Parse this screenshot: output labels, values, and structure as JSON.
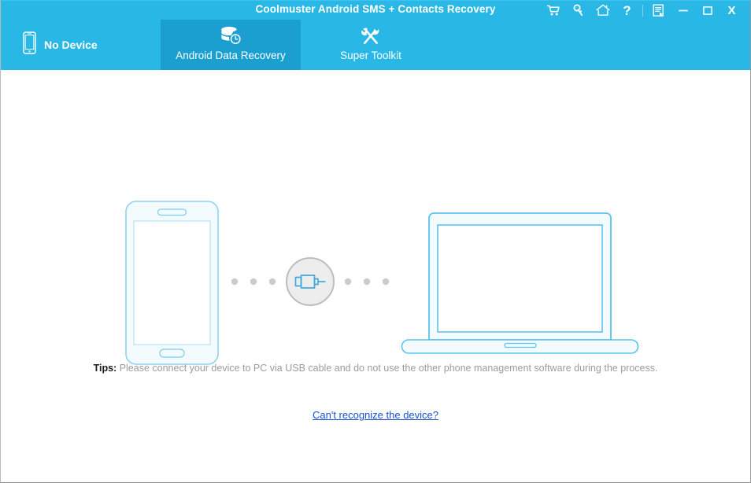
{
  "window": {
    "title": "Coolmuster Android SMS + Contacts Recovery",
    "accent_color": "#29b8e5",
    "active_tab_color": "#1a9fd0",
    "controls": [
      {
        "name": "cart-icon",
        "label": "Buy"
      },
      {
        "name": "key-icon",
        "label": "Register"
      },
      {
        "name": "home-icon",
        "label": "Home"
      },
      {
        "name": "help-icon",
        "label": "?"
      },
      {
        "name": "feedback-icon",
        "label": "Feedback"
      },
      {
        "name": "minimize-icon",
        "label": "Minimize"
      },
      {
        "name": "maximize-icon",
        "label": "Maximize"
      },
      {
        "name": "close-icon",
        "label": "X"
      }
    ]
  },
  "device": {
    "icon": "phone-icon",
    "status": "No Device"
  },
  "tabs": [
    {
      "id": "android-data-recovery",
      "label": "Android Data Recovery",
      "icon": "database-clock-icon",
      "active": true
    },
    {
      "id": "super-toolkit",
      "label": "Super Toolkit",
      "icon": "tools-icon",
      "active": false
    }
  ],
  "illustration": {
    "phone": "phone-outline",
    "computer": "laptop-outline",
    "connector": "usb-connector-icon",
    "dot_count_left": 3,
    "dot_count_right": 3,
    "line_color": "#5bc3ee",
    "fill_color": "#f4fbfe",
    "dot_color": "#c9cdd1",
    "circle_fill": "#ededed",
    "circle_border": "#bdbdbd"
  },
  "tips": {
    "label": "Tips:",
    "text": "Please connect your device to PC via USB cable and do not use the other phone management software during the process."
  },
  "help": {
    "link_text": "Can't recognize the device?",
    "link_color": "#1a4fd6"
  }
}
